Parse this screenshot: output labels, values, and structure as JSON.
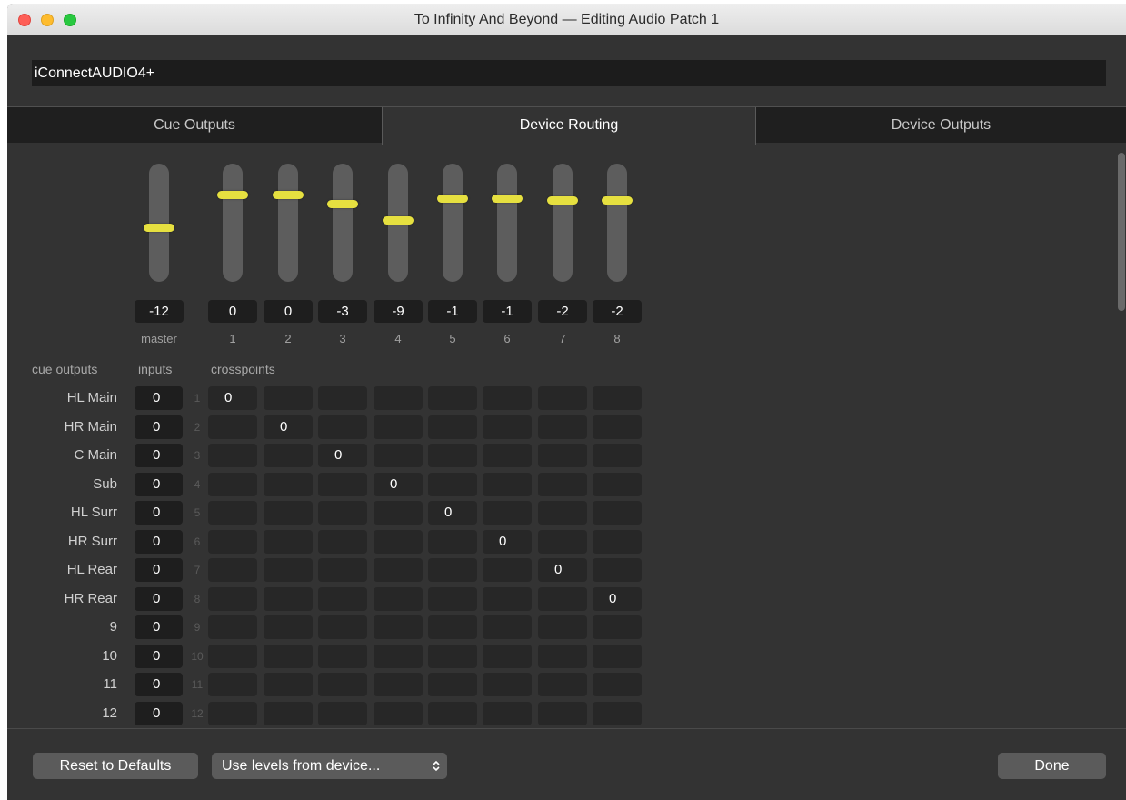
{
  "window": {
    "title": "To Infinity And Beyond — Editing Audio Patch 1"
  },
  "device": {
    "name": "iConnectAUDIO4+"
  },
  "tabs": [
    {
      "label": "Cue Outputs",
      "selected": false
    },
    {
      "label": "Device Routing",
      "selected": true
    },
    {
      "label": "Device Outputs",
      "selected": false
    }
  ],
  "faders": [
    {
      "label": "master",
      "level": "-12",
      "position": 0.54
    },
    {
      "label": "1",
      "level": "0",
      "position": 0.26
    },
    {
      "label": "2",
      "level": "0",
      "position": 0.26
    },
    {
      "label": "3",
      "level": "-3",
      "position": 0.34
    },
    {
      "label": "4",
      "level": "-9",
      "position": 0.48
    },
    {
      "label": "5",
      "level": "-1",
      "position": 0.29
    },
    {
      "label": "6",
      "level": "-1",
      "position": 0.29
    },
    {
      "label": "7",
      "level": "-2",
      "position": 0.31
    },
    {
      "label": "8",
      "level": "-2",
      "position": 0.31
    }
  ],
  "sections": {
    "cue_outputs": "cue outputs",
    "inputs": "inputs",
    "crosspoints": "crosspoints"
  },
  "rows": [
    {
      "label": "HL Main",
      "input": "0",
      "num": "1",
      "cells": [
        "0",
        "",
        "",
        "",
        "",
        "",
        "",
        ""
      ]
    },
    {
      "label": "HR Main",
      "input": "0",
      "num": "2",
      "cells": [
        "",
        "0",
        "",
        "",
        "",
        "",
        "",
        ""
      ]
    },
    {
      "label": "C Main",
      "input": "0",
      "num": "3",
      "cells": [
        "",
        "",
        "0",
        "",
        "",
        "",
        "",
        ""
      ]
    },
    {
      "label": "Sub",
      "input": "0",
      "num": "4",
      "cells": [
        "",
        "",
        "",
        "0",
        "",
        "",
        "",
        ""
      ]
    },
    {
      "label": "HL Surr",
      "input": "0",
      "num": "5",
      "cells": [
        "",
        "",
        "",
        "",
        "0",
        "",
        "",
        ""
      ]
    },
    {
      "label": "HR Surr",
      "input": "0",
      "num": "6",
      "cells": [
        "",
        "",
        "",
        "",
        "",
        "0",
        "",
        ""
      ]
    },
    {
      "label": "HL Rear",
      "input": "0",
      "num": "7",
      "cells": [
        "",
        "",
        "",
        "",
        "",
        "",
        "0",
        ""
      ]
    },
    {
      "label": "HR Rear",
      "input": "0",
      "num": "8",
      "cells": [
        "",
        "",
        "",
        "",
        "",
        "",
        "",
        "0"
      ]
    },
    {
      "label": "9",
      "input": "0",
      "num": "9",
      "cells": [
        "",
        "",
        "",
        "",
        "",
        "",
        "",
        ""
      ]
    },
    {
      "label": "10",
      "input": "0",
      "num": "10",
      "cells": [
        "",
        "",
        "",
        "",
        "",
        "",
        "",
        ""
      ]
    },
    {
      "label": "11",
      "input": "0",
      "num": "11",
      "cells": [
        "",
        "",
        "",
        "",
        "",
        "",
        "",
        ""
      ]
    },
    {
      "label": "12",
      "input": "0",
      "num": "12",
      "cells": [
        "",
        "",
        "",
        "",
        "",
        "",
        "",
        ""
      ]
    }
  ],
  "footer": {
    "reset_label": "Reset to Defaults",
    "levels_popup": "Use levels from device...",
    "done_label": "Done"
  },
  "colors": {
    "fader_knob": "#e6e040",
    "background": "#333333",
    "field": "#1e1e1e"
  }
}
